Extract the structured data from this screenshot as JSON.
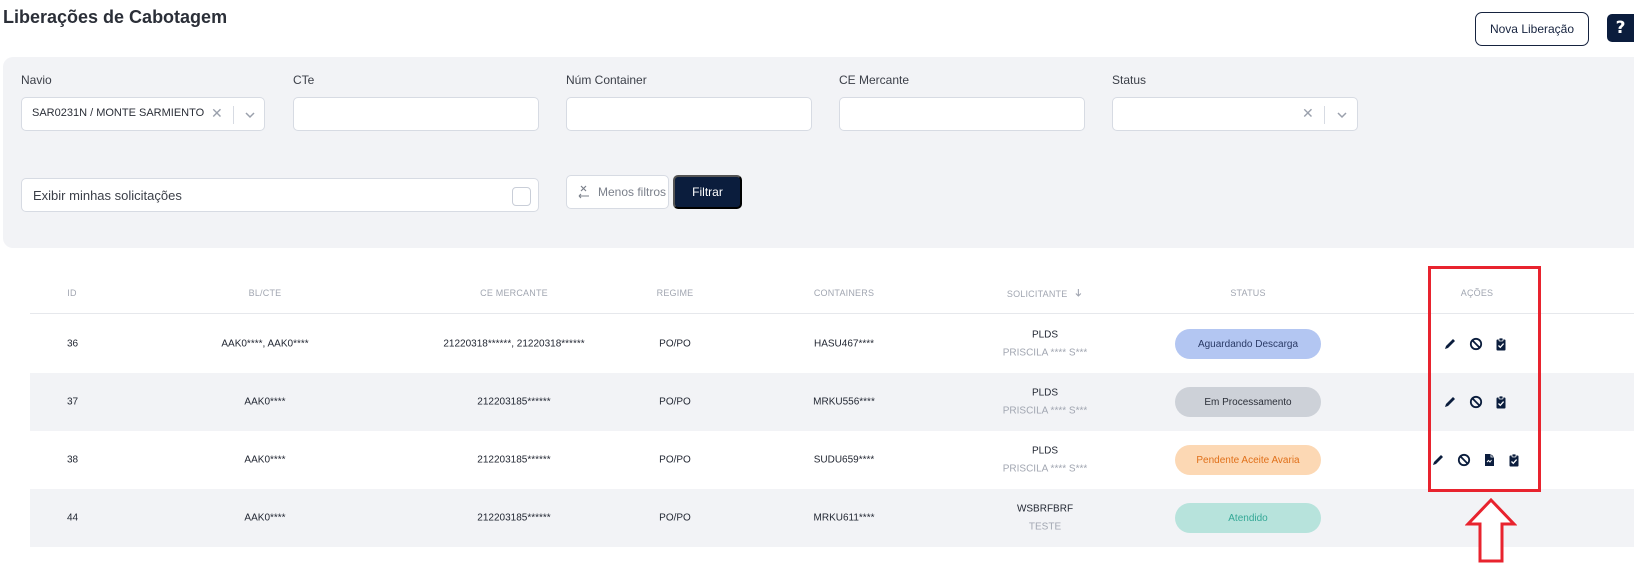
{
  "page": {
    "title": "Liberações de Cabotagem"
  },
  "header": {
    "nova_label": "Nova Liberação",
    "help_label": "?"
  },
  "filters": {
    "navio": {
      "label": "Navio",
      "value": "SAR0231N / MONTE SARMIENTO"
    },
    "cte": {
      "label": "CTe",
      "value": ""
    },
    "num_container": {
      "label": "Núm Container",
      "value": ""
    },
    "ce_mercante": {
      "label": "CE Mercante",
      "value": ""
    },
    "status": {
      "label": "Status",
      "value": ""
    },
    "exibir_label": "Exibir minhas solicitações",
    "menos_filtros_label": "Menos filtros",
    "filtrar_label": "Filtrar"
  },
  "table": {
    "headers": {
      "id": "ID",
      "bl_cte": "BL/CTE",
      "ce_mercante": "CE MERCANTE",
      "regime": "REGIME",
      "containers": "CONTAINERS",
      "solicitante": "SOLICITANTE",
      "status": "STATUS",
      "acoes": "AÇÕES"
    },
    "rows": [
      {
        "id": "36",
        "bl_cte": "AAK0****, AAK0****",
        "ce_mercante": "21220318******, 21220318******",
        "regime": "PO/PO",
        "containers": "HASU467****",
        "solicitante": "PLDS",
        "solicitante_sub": "PRISCILA **** S***",
        "status": "Aguardando Descarga",
        "status_color": "#b3c6f2",
        "status_text_color": "#2a3a66"
      },
      {
        "id": "37",
        "bl_cte": "AAK0****",
        "ce_mercante": "212203185******",
        "regime": "PO/PO",
        "containers": "MRKU556****",
        "solicitante": "PLDS",
        "solicitante_sub": "PRISCILA **** S***",
        "status": "Em Processamento",
        "status_color": "#cdd1d8",
        "status_text_color": "#2b2f38"
      },
      {
        "id": "38",
        "bl_cte": "AAK0****",
        "ce_mercante": "212203185******",
        "regime": "PO/PO",
        "containers": "SUDU659****",
        "solicitante": "PLDS",
        "solicitante_sub": "PRISCILA **** S***",
        "status": "Pendente Aceite Avaria",
        "status_color": "#fcd8b4",
        "status_text_color": "#e0701a"
      },
      {
        "id": "44",
        "bl_cte": "AAK0****",
        "ce_mercante": "212203185******",
        "regime": "PO/PO",
        "containers": "MRKU611****",
        "solicitante": "WSBRFBRF",
        "solicitante_sub": "TESTE",
        "status": "Atendido",
        "status_color": "#b7e3dc",
        "status_text_color": "#34a896"
      }
    ]
  },
  "icons": {
    "edit": "pencil-icon",
    "cancel": "ban-icon",
    "document": "file-icon",
    "approve": "clipboard-check-icon",
    "sort": "arrow-down-icon",
    "clear": "close-icon",
    "chevron": "chevron-down-icon"
  },
  "annotation": {
    "box_color": "#e8232e"
  }
}
